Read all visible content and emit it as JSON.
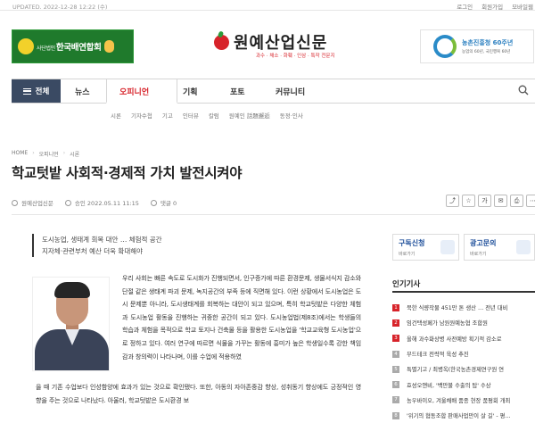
{
  "topbar": {
    "updated": "UPDATED. 2022-12-28 12:22 (수)",
    "links": [
      "로그인",
      "회원가입",
      "모바일웹"
    ]
  },
  "header": {
    "banner_left": {
      "small": "사단법인",
      "text": "한국배연합회"
    },
    "logo": "원예산업신문",
    "logo_sub": "과수 · 채소 · 화훼 · 인삼 · 특작 전문지",
    "banner_right": {
      "title": "농촌진흥청 60주년",
      "sub": "농업의 60년, 국민행복 60년"
    }
  },
  "nav": {
    "all_label": "전체",
    "items": [
      "뉴스",
      "오피니언",
      "기획",
      "포토",
      "커뮤니티"
    ],
    "active": "오피니언",
    "search_icon": "search-icon"
  },
  "subnav": [
    "시론",
    "기자수첩",
    "기고",
    "인터뷰",
    "칼럼",
    "원예인 話題邂逅",
    "동정·인사"
  ],
  "breadcrumb": [
    "HOME",
    "오피니언",
    "시론"
  ],
  "article": {
    "title": "학교텃밭 사회적·경제적 가치 발전시켜야",
    "author": "원예산업신문",
    "approved": "승인 2022.05.11 11:15",
    "comments": "댓글 0",
    "summary_lines": [
      "도시농업, 생태계 회복 대안 … 체험적 공간",
      "지자체·관련부처 예산 더욱 확대해야"
    ],
    "body": "우리 사회는 빠른 속도로 도시화가 진행되면서, 인구증가에 따른 환경문제, 생물서식지 감소와 단절 같은 생태계 파괴 문제, 녹지공간의 부족 등에 직면해 있다. 이런 상황에서 도시농업은 도시 문제뿐 아니라, 도시생태계를 회복하는 대안이 되고 있으며, 특히 학교텃밭은 다양한 체험과 도시농업 활동을 진행하는 귀중한 공간이 되고 있다. 도시농업법(제8조)에서는 학생들의 학습과 체험을 목적으로 학교 토지나 건축물 등을 활용한 도시농업을 '학교교육형 도시농업'으로 정하고 있다. 여러 연구에 따르면 식물을 가꾸는 활동에 흥미가 높은 학생일수록 강한 책임감과 창의력이 나타나며, 이를 수업에 적용하였",
    "body2": "을 때 기존 수업보다 인성함양에 효과가 있는 것으로 확인됐다. 또한, 아동의 자아존중감 향상, 성취동기 향상에도 긍정적인 영향을 주는 것으로 나타났다. 아울러, 학교텃밭은 도시환경 보"
  },
  "sidebar": {
    "banner1": {
      "title": "구독신청",
      "sub": "바로가기"
    },
    "banner2": {
      "title": "광고문의",
      "sub": "바로가기"
    },
    "section_title": "인기기사",
    "items": [
      "북한 식량작물 451만 톤 생산 … 전년 대비",
      "임건택성페가 남원원예농협 조합원",
      "올해 과수화상병 사전예방 획기적 감소로",
      "부드테크 전략적 육성 추진",
      "특별기고 / 최병옥(한국농촌경제연구원 연",
      "효성오앤비, '백만불 수출의 탑' 수상",
      "농우바이오, 겨울채배 품종 현장 품평회 개최",
      "'위기의 협동조합 판매사업만이 살 길' - 평…"
    ]
  }
}
